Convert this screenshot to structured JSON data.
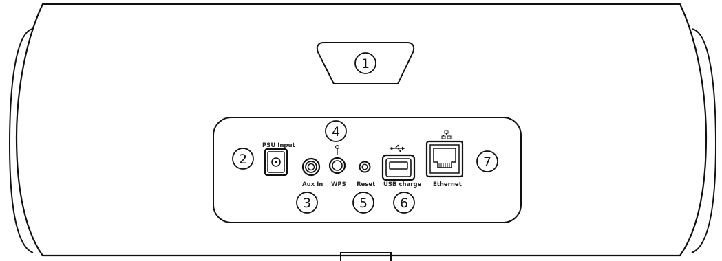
{
  "ports": {
    "psu_input": "PSU Input",
    "aux_in": "Aux In",
    "wps": "WPS",
    "reset": "Reset",
    "usb_charge": "USB charge",
    "ethernet": "Ethernet"
  },
  "callouts": {
    "c1": "1",
    "c2": "2",
    "c3": "3",
    "c4": "4",
    "c5": "5",
    "c6": "6",
    "c7": "7"
  },
  "icons": {
    "usb_symbol": "usb-icon",
    "ethernet_symbol": "network-icon"
  }
}
